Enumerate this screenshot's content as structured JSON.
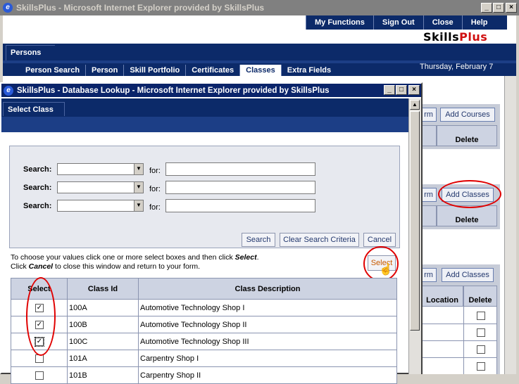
{
  "outer_window": {
    "title": "SkillsPlus - Microsoft Internet Explorer provided by SkillsPlus"
  },
  "top_nav": {
    "items": [
      "My Functions",
      "Sign Out",
      "Close",
      "Help"
    ]
  },
  "brand": {
    "part1": "Skills",
    "part2": "Plus"
  },
  "section_tab": "Persons",
  "sub_tabs": [
    "Person Search",
    "Person",
    "Skill Portfolio",
    "Certificates",
    "Classes",
    "Extra Fields"
  ],
  "active_sub_tab": "Classes",
  "date": "Thursday, February 7",
  "right_panels": {
    "p1": {
      "btn_frag": "rm",
      "btn": "Add Courses",
      "col": "Delete"
    },
    "p2": {
      "btn_frag": "rm",
      "btn": "Add Classes",
      "col": "Delete"
    },
    "p3": {
      "btn_frag": "rm",
      "btn": "Add Classes",
      "col1": "Location",
      "col2": "Delete"
    }
  },
  "popup": {
    "title": "SkillsPlus - Database Lookup - Microsoft Internet Explorer provided by SkillsPlus",
    "tab": "Select Class",
    "search_label": "Search:",
    "for_label": "for:",
    "buttons": {
      "search": "Search",
      "clear": "Clear Search Criteria",
      "cancel": "Cancel",
      "select": "Select"
    },
    "instructions": {
      "line1_pre": "To choose your values click one or more select boxes and then click ",
      "line1_em": "Select",
      "line1_post": ".",
      "line2_pre": "Click ",
      "line2_em": "Cancel",
      "line2_post": " to close this window and return to your form."
    },
    "table": {
      "headers": [
        "Select",
        "Class Id",
        "Class Description"
      ],
      "rows": [
        {
          "checked": true,
          "id": "100A",
          "desc": "Automotive Technology Shop I"
        },
        {
          "checked": true,
          "id": "100B",
          "desc": "Automotive Technology Shop II"
        },
        {
          "checked": true,
          "id": "100C",
          "desc": "Automotive Technology Shop III"
        },
        {
          "checked": false,
          "id": "101A",
          "desc": "Carpentry Shop I"
        },
        {
          "checked": false,
          "id": "101B",
          "desc": "Carpentry Shop II"
        }
      ]
    }
  },
  "colors": {
    "navy": "#0c2a69",
    "title_active": "#0a246a",
    "annotation_red": "#e00000",
    "select_orange": "#c85a00"
  }
}
